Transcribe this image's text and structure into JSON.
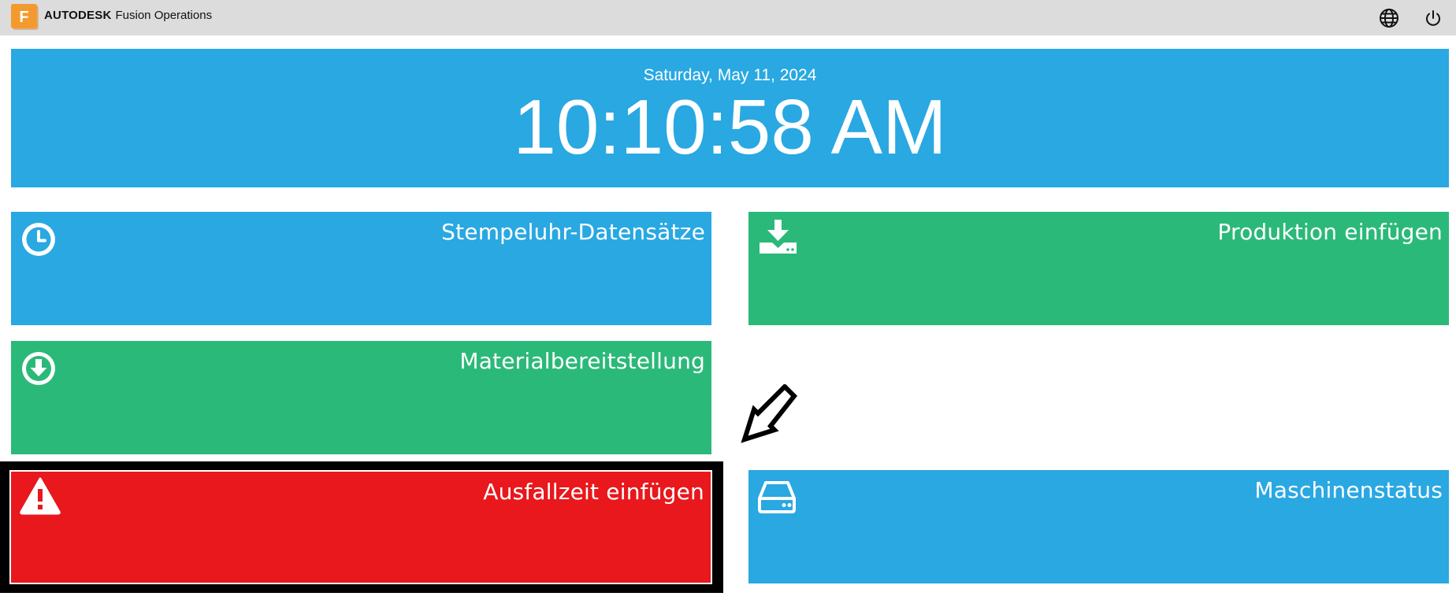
{
  "app": {
    "logo_letter": "F",
    "brand_bold": "AUTODESK",
    "brand_name": "Fusion Operations",
    "icons": [
      "globe-icon",
      "power-icon"
    ]
  },
  "clock": {
    "date": "Saturday, May 11, 2024",
    "time": "10:10:58 AM"
  },
  "tiles": [
    {
      "label": "Stempeluhr-Datensätze",
      "icon": "clock-icon",
      "color": "#29a8e2"
    },
    {
      "label": "Produktion einfügen",
      "icon": "download-tray-icon",
      "color": "#2bb979"
    },
    {
      "label": "Materialbereitstellung",
      "icon": "download-circle-icon",
      "color": "#2bb979"
    },
    {
      "label": "Ausfallzeit einfügen",
      "icon": "warning-icon",
      "color": "#e8181c",
      "selected": true
    },
    {
      "label": "Maschinenstatus",
      "icon": "hard-drive-icon",
      "color": "#29a8e2"
    }
  ],
  "colors": {
    "topbar": "#dcdcdc",
    "accent_blue": "#29a8e2",
    "accent_green": "#2bb979",
    "alert_red": "#e8181c",
    "logo_orange": "#f08a24"
  }
}
